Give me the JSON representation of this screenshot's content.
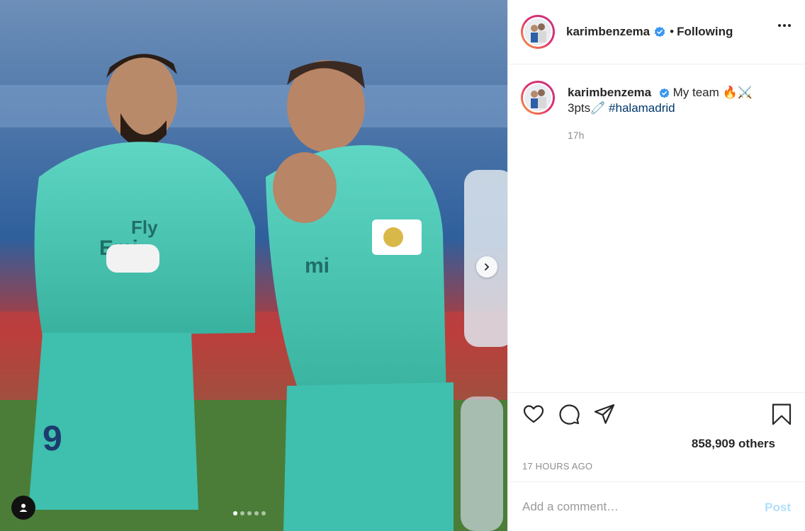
{
  "post": {
    "username": "karimbenzema",
    "separator": "•",
    "follow_status": "Following",
    "caption_text": "My team 🔥⚔️",
    "caption_line2": "3pts🧷",
    "hashtag": "#halamadrid",
    "time_short": "17h",
    "likes": "858,909 others",
    "time_long": "17 HOURS AGO",
    "carousel_total": 5,
    "carousel_index": 1
  },
  "icons": [
    "verified-badge-icon",
    "more-options-icon",
    "heart-icon",
    "comment-icon",
    "share-icon",
    "bookmark-icon",
    "chevron-right-icon",
    "user-tag-icon"
  ],
  "comment": {
    "placeholder": "Add a comment…",
    "post_label": "Post"
  },
  "colors": {
    "verified": "#3897f0",
    "hashtag": "#00376b",
    "muted": "#8e8e8e",
    "post_disabled": "#b2dffc",
    "jersey": "#4fc7b5"
  }
}
